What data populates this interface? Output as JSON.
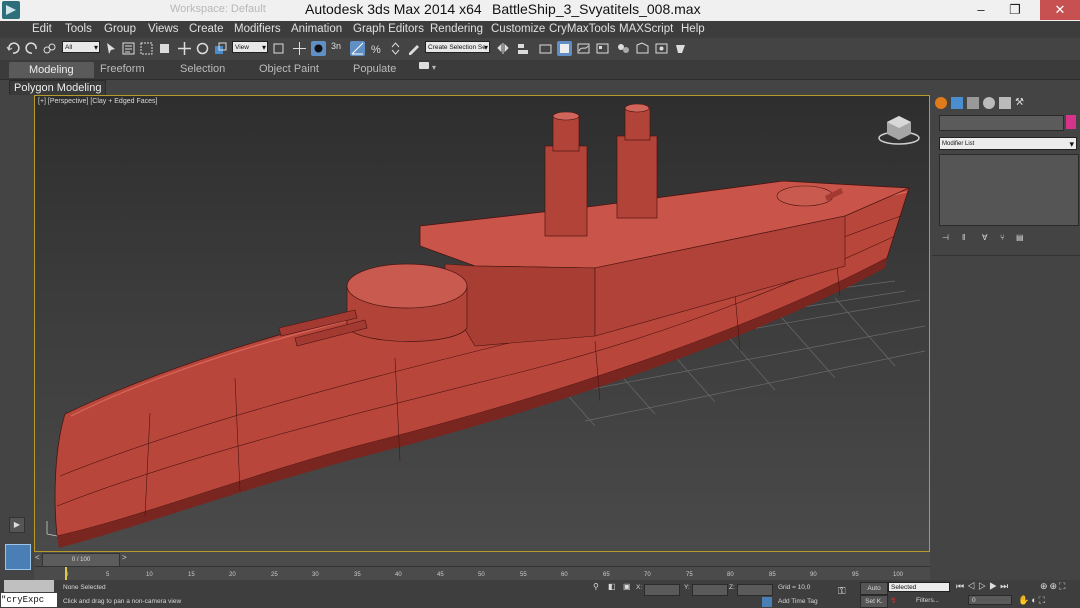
{
  "window": {
    "ghost_text": "Workspace: Default",
    "title": "Autodesk 3ds Max  2014 x64",
    "filename": "BattleShip_3_Svyatitels_008.max",
    "controls": [
      "–",
      "❐",
      "✕"
    ]
  },
  "menu": [
    "Edit",
    "Tools",
    "Group",
    "Views",
    "Create",
    "Modifiers",
    "Animation",
    "Graph Editors",
    "Rendering",
    "Customize",
    "CryMaxTools",
    "MAXScript",
    "Help"
  ],
  "toolbar": {
    "selection_filter": "All",
    "ref_coord": "View",
    "named_selection": "Create Selection Se",
    "snap_label": "3n"
  },
  "ribbon": {
    "tabs": [
      "Modeling",
      "Freeform",
      "Selection",
      "Object Paint",
      "Populate"
    ],
    "active_tab": "Modeling",
    "panel_button": "Polygon Modeling"
  },
  "viewport": {
    "label": "[+] [Perspective] [Clay + Edged Faces]",
    "object_color": "#b9463b"
  },
  "command_panel": {
    "modifier_list": "Modifier List",
    "object_color": "#d6338a"
  },
  "timeline": {
    "frame_display": "0 / 100",
    "ticks": [
      "0",
      "5",
      "10",
      "15",
      "20",
      "25",
      "30",
      "35",
      "40",
      "45",
      "50",
      "55",
      "60",
      "65",
      "70",
      "75",
      "80",
      "85",
      "90",
      "95",
      "100"
    ]
  },
  "status": {
    "maxscript": "\"cryExpc",
    "selection": "None Selected",
    "prompt": "Click and drag to pan a non-camera view",
    "x_label": "X:",
    "y_label": "Y:",
    "z_label": "Z:",
    "grid": "Grid = 10,0",
    "add_time_tag": "Add Time Tag",
    "auto_key": "Auto",
    "set_key": "Set K.",
    "key_filter_value": "Selected",
    "filters": "Filters...",
    "frame_field": "0"
  }
}
